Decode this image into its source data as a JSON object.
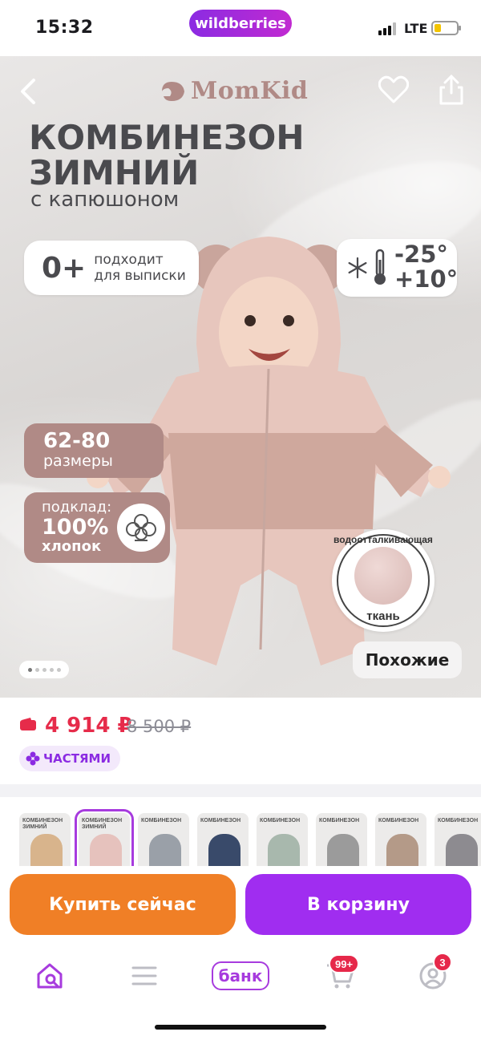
{
  "status_bar": {
    "time": "15:32",
    "app_name": "wildberries",
    "network": "LTE",
    "battery_level": 0.3
  },
  "hero": {
    "brand_logo": "MomKid",
    "title_line1": "КОМБИНЕЗОН",
    "title_line2": "ЗИМНИЙ",
    "subtitle": "с капюшоном",
    "age_value": "0+",
    "age_text_line1": "подходит",
    "age_text_line2": "для выписки",
    "temp_max": "-25°",
    "temp_min": "+10°",
    "sizes_value": "62-80",
    "sizes_label": "размеры",
    "lining_label": "подклад:",
    "lining_value": "100%",
    "lining_material": "хлопок",
    "waterproof_top": "водоотталкивающая",
    "waterproof_bottom": "ткань",
    "similar_button": "Похожие",
    "image_count": 5,
    "image_index": 1,
    "icons": [
      "back-arrow-icon",
      "heart-icon",
      "share-icon",
      "snowflake-icon",
      "thermometer-icon",
      "cotton-icon"
    ]
  },
  "price": {
    "current": "4 914 ₽",
    "old": "8 500 ₽",
    "installments_label": "ЧАСТЯМИ",
    "accent_color": "#e62b4a"
  },
  "thumbnails": [
    {
      "color": "#d8b48c",
      "title": "КОМБИНЕЗОН ЗИМНИЙ"
    },
    {
      "color": "#e6c2bd",
      "title": "КОМБИНЕЗОН ЗИМНИЙ",
      "selected": true
    },
    {
      "color": "#9aa0a8",
      "title": "КОМБИНЕЗОН"
    },
    {
      "color": "#394a6a",
      "title": "КОМБИНЕЗОН"
    },
    {
      "color": "#a8b8ad",
      "title": "КОМБИНЕЗОН"
    },
    {
      "color": "#9b9b9b",
      "title": "КОМБИНЕЗОН"
    },
    {
      "color": "#b49a88",
      "title": "КОМБИНЕЗОН"
    },
    {
      "color": "#8d8b90",
      "title": "КОМБИНЕЗОН"
    }
  ],
  "actions": {
    "buy_now": "Купить сейчас",
    "add_to_cart": "В корзину",
    "buy_color": "#f07f26",
    "cart_color": "#a02df0"
  },
  "nav": {
    "bank_label": "банк",
    "cart_badge": "99+",
    "profile_badge": "3",
    "icons": [
      "home-search-icon",
      "menu-icon",
      "bank-icon",
      "cart-icon",
      "profile-icon"
    ]
  }
}
